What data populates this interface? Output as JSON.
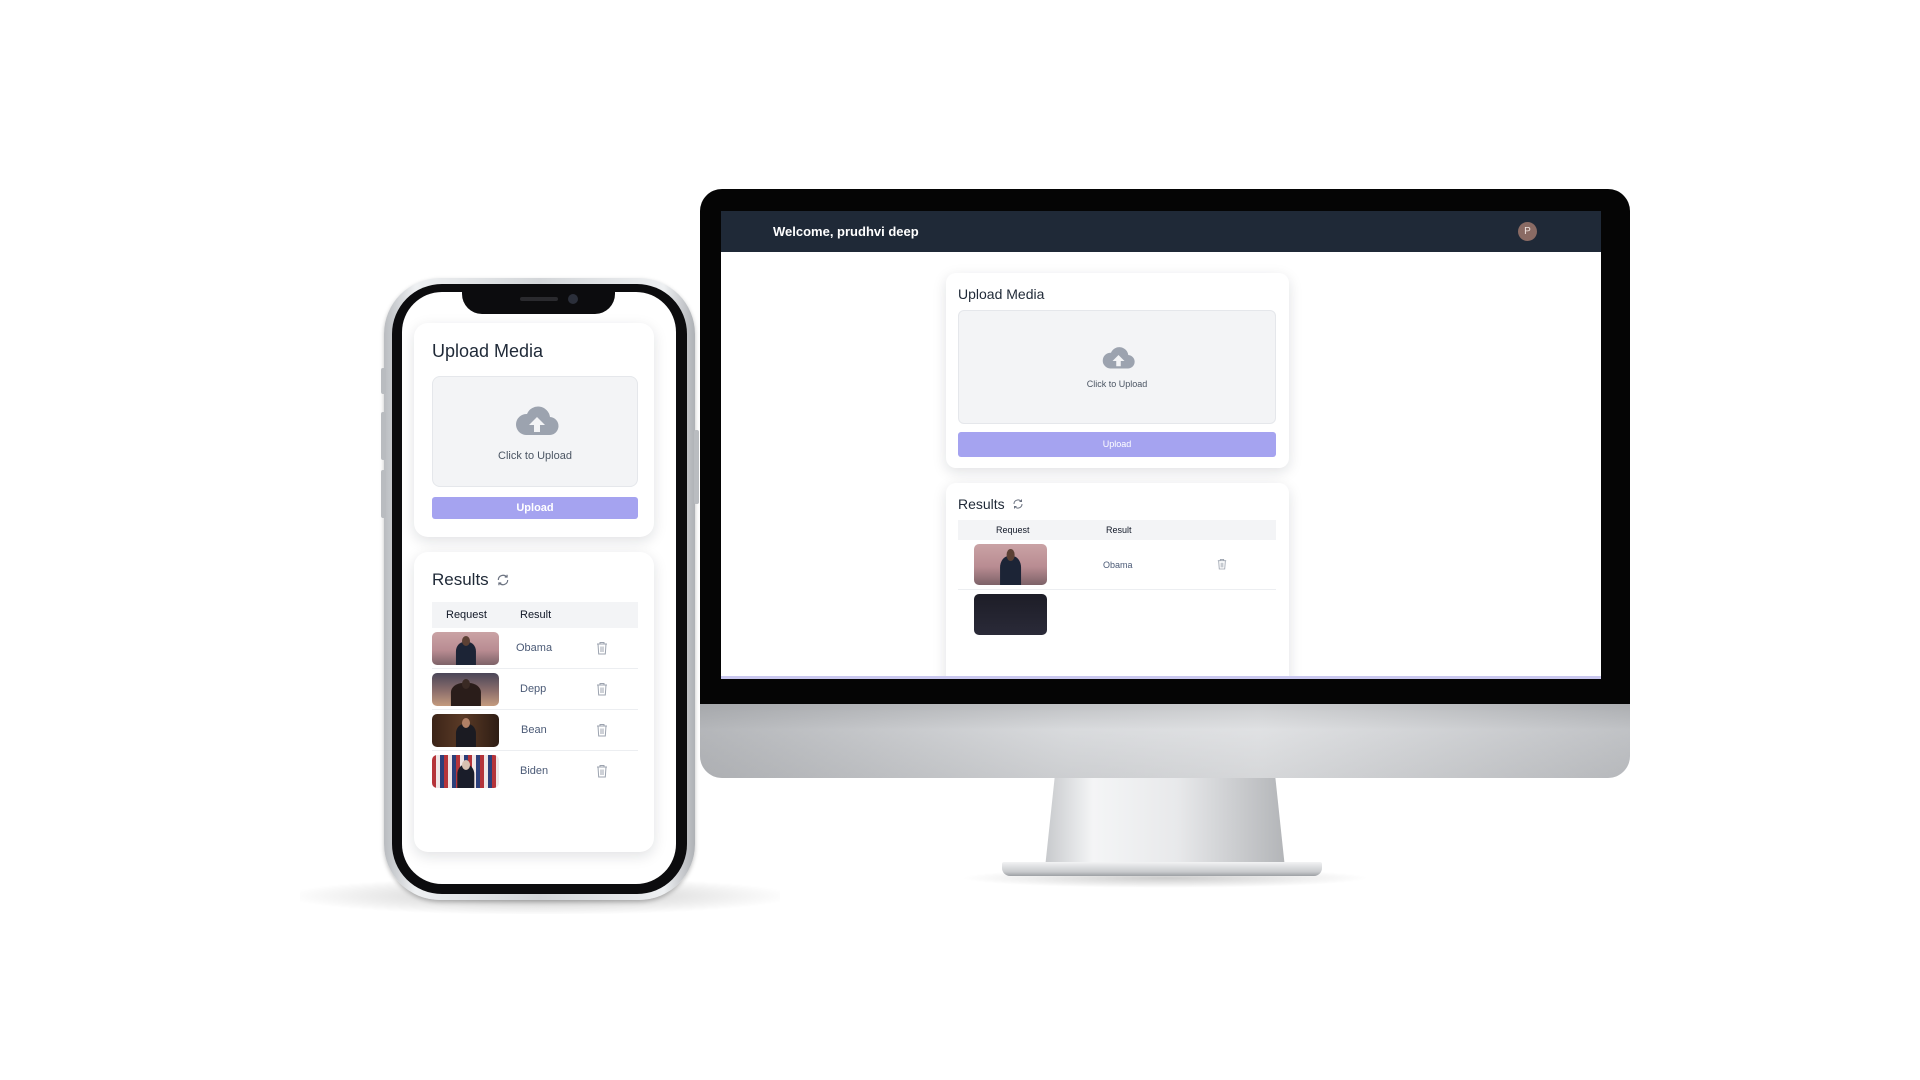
{
  "navbar": {
    "welcome": "Welcome, prudhvi deep",
    "avatar_initial": "P"
  },
  "upload": {
    "title": "Upload Media",
    "dropzone_text": "Click to Upload",
    "button_label": "Upload"
  },
  "results": {
    "title": "Results",
    "columns": [
      "Request",
      "Result"
    ],
    "rows": [
      {
        "result": "Obama"
      },
      {
        "result": "Depp"
      },
      {
        "result": "Bean"
      },
      {
        "result": "Biden"
      }
    ]
  },
  "colors": {
    "navbar_bg": "#1f2937",
    "upload_button": "#a5a3f0",
    "dropzone_bg": "#f3f4f6",
    "result_text": "#4b5a76"
  },
  "icons": {
    "upload": "cloud-upload-icon",
    "refresh": "refresh-icon",
    "delete": "trash-icon"
  }
}
